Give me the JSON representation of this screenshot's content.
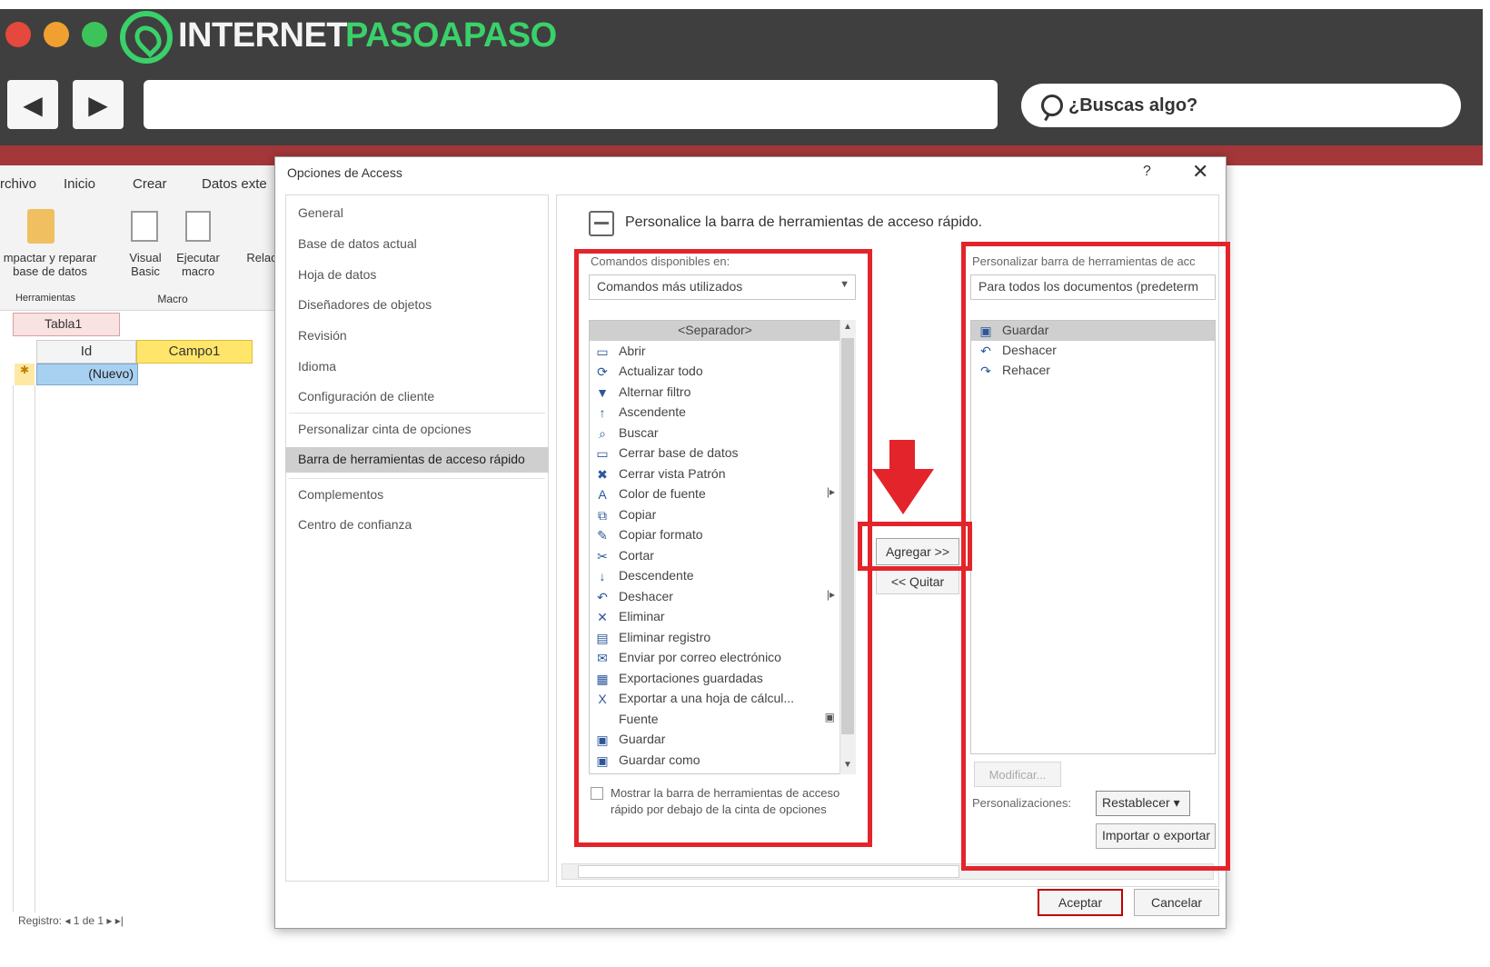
{
  "browser": {
    "logo_part1": "INTERNET",
    "logo_part2": "PASOAPASO",
    "back_icon": "◀",
    "forward_icon": "▶",
    "search_placeholder": "¿Buscas algo?",
    "window_dots": [
      "#e5483c",
      "#f0a030",
      "#3cc45a"
    ]
  },
  "access": {
    "ribbon_tabs": [
      "rchivo",
      "Inicio",
      "Crear",
      "Datos exte"
    ],
    "ribbon_buttons": {
      "compactar": "mpactar y reparar\nbase de datos",
      "visual_basic": "Visual\nBasic",
      "ejecutar_macro": "Ejecutar\nmacro",
      "relaciones": "Relac"
    },
    "ribbon_groups": {
      "herramientas": "Herramientas",
      "macro": "Macro"
    },
    "table_tab": "Tabla1",
    "col_id": "Id",
    "col_campo": "Campo1",
    "new_row": "(Nuevo)",
    "status": "Registro: ◂  1 de 1  ▸ ▸|"
  },
  "dialog": {
    "title": "Opciones de Access",
    "help": "?",
    "close": "✕",
    "nav": [
      "General",
      "Base de datos actual",
      "Hoja de datos",
      "Diseñadores de objetos",
      "Revisión",
      "Idioma",
      "Configuración de cliente",
      "Personalizar cinta de opciones",
      "Barra de herramientas de acceso rápido",
      "Complementos",
      "Centro de confianza"
    ],
    "nav_selected_index": 8,
    "header": "Personalice la barra de herramientas de acceso rápido.",
    "commands_label": "Comandos disponibles en:",
    "commands_select": "Comandos más utilizados",
    "commands": [
      {
        "label": "<Separador>",
        "icon": "",
        "sub": ""
      },
      {
        "label": "Abrir",
        "icon": "▭",
        "sub": ""
      },
      {
        "label": "Actualizar todo",
        "icon": "⟳",
        "sub": ""
      },
      {
        "label": "Alternar filtro",
        "icon": "▼",
        "sub": ""
      },
      {
        "label": "Ascendente",
        "icon": "↑",
        "sub": ""
      },
      {
        "label": "Buscar",
        "icon": "⌕",
        "sub": ""
      },
      {
        "label": "Cerrar base de datos",
        "icon": "▭",
        "sub": ""
      },
      {
        "label": "Cerrar vista Patrón",
        "icon": "✖",
        "sub": ""
      },
      {
        "label": "Color de fuente",
        "icon": "A",
        "sub": "|▸"
      },
      {
        "label": "Copiar",
        "icon": "⧉",
        "sub": ""
      },
      {
        "label": "Copiar formato",
        "icon": "✎",
        "sub": ""
      },
      {
        "label": "Cortar",
        "icon": "✂",
        "sub": ""
      },
      {
        "label": "Descendente",
        "icon": "↓",
        "sub": ""
      },
      {
        "label": "Deshacer",
        "icon": "↶",
        "sub": "|▸"
      },
      {
        "label": "Eliminar",
        "icon": "✕",
        "sub": ""
      },
      {
        "label": "Eliminar registro",
        "icon": "▤",
        "sub": ""
      },
      {
        "label": "Enviar por correo electrónico",
        "icon": "✉",
        "sub": ""
      },
      {
        "label": "Exportaciones guardadas",
        "icon": "▦",
        "sub": ""
      },
      {
        "label": "Exportar a una hoja de cálcul...",
        "icon": "X",
        "sub": ""
      },
      {
        "label": "Fuente",
        "icon": "",
        "sub": "▣"
      },
      {
        "label": "Guardar",
        "icon": "▣",
        "sub": ""
      },
      {
        "label": "Guardar como",
        "icon": "▣",
        "sub": ""
      }
    ],
    "show_below_label": "Mostrar la barra de herramientas de acceso rápido por debajo de la cinta de opciones",
    "customize_label": "Personalizar barra de herramientas de acc",
    "customize_select": "Para todos los documentos (predeterm",
    "customized_items": [
      {
        "label": "Guardar",
        "icon": "▣"
      },
      {
        "label": "Deshacer",
        "icon": "↶"
      },
      {
        "label": "Rehacer",
        "icon": "↷"
      }
    ],
    "add_button": "Agregar >>",
    "remove_button": "<< Quitar",
    "modify_button": "Modificar...",
    "personalizations_label": "Personalizaciones:",
    "reset_button": "Restablecer ▾",
    "import_button": "Importar o exportar",
    "ok_button": "Aceptar",
    "cancel_button": "Cancelar"
  },
  "colors": {
    "annotation_red": "#e3242b",
    "access_red": "#a4373a",
    "logo_green": "#3ad06a"
  }
}
